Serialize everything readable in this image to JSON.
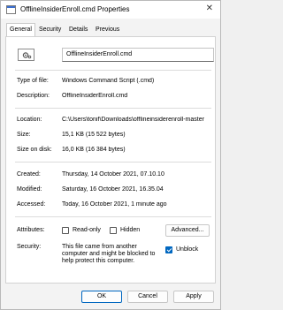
{
  "window": {
    "title": "OfflineInsiderEnroll.cmd Properties",
    "close_glyph": "✕"
  },
  "tabs": [
    {
      "label": "General"
    },
    {
      "label": "Security"
    },
    {
      "label": "Details"
    },
    {
      "label": "Previous Versions"
    }
  ],
  "file": {
    "name": "OfflineInsiderEnroll.cmd"
  },
  "rows": [
    {
      "label": "Type of file:",
      "value": "Windows Command Script (.cmd)"
    },
    {
      "label": "Description:",
      "value": "OfflineInsiderEnroll.cmd"
    },
    {
      "label": "Location:",
      "value": "C:\\Users\\tonif\\Downloads\\offlineinsiderenroll-master"
    },
    {
      "label": "Size:",
      "value": "15,1 KB (15 522 bytes)"
    },
    {
      "label": "Size on disk:",
      "value": "16,0 KB (16 384 bytes)"
    },
    {
      "label": "Created:",
      "value": "Thursday, 14 October 2021, 07.10.10"
    },
    {
      "label": "Modified:",
      "value": "Saturday, 16 October 2021, 16.35.04"
    },
    {
      "label": "Accessed:",
      "value": "Today, 16 October 2021, 1 minute ago"
    }
  ],
  "attributes": {
    "label": "Attributes:",
    "read_only": {
      "label": "Read-only",
      "checked": false
    },
    "hidden": {
      "label": "Hidden",
      "checked": false
    },
    "advanced_button": "Advanced..."
  },
  "security": {
    "label": "Security:",
    "text": "This file came from another computer and might be blocked to help protect this computer.",
    "unblock": {
      "label": "Unblock",
      "checked": true
    }
  },
  "buttons": {
    "ok": "OK",
    "cancel": "Cancel",
    "apply": "Apply"
  },
  "colors": {
    "accent": "#0067c0"
  }
}
